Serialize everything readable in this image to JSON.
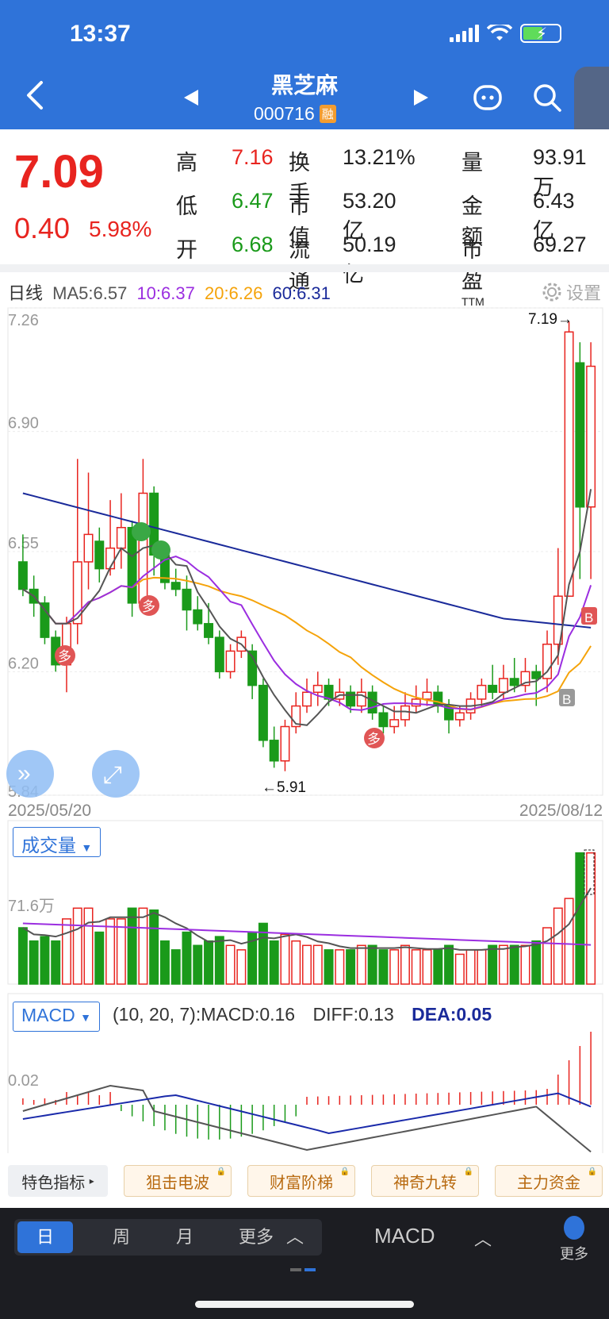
{
  "status": {
    "time": "13:37"
  },
  "header": {
    "name": "黑芝麻",
    "code": "000716",
    "badge": "融"
  },
  "quote": {
    "price": "7.09",
    "change": "0.40",
    "change_pct": "5.98%",
    "fields": [
      {
        "label": "高",
        "value": "7.16",
        "color": "red"
      },
      {
        "label": "换手",
        "value": "13.21%",
        "color": "dark"
      },
      {
        "label": "量",
        "value": "93.91万",
        "color": "dark"
      },
      {
        "label": "低",
        "value": "6.47",
        "color": "green"
      },
      {
        "label": "市值",
        "value": "53.20亿",
        "color": "dark"
      },
      {
        "label": "金额",
        "value": "6.43亿",
        "color": "dark"
      },
      {
        "label": "开",
        "value": "6.68",
        "color": "green"
      },
      {
        "label": "流通",
        "value": "50.19亿",
        "color": "dark"
      },
      {
        "label": "市盈TTM",
        "value": "69.27",
        "color": "dark"
      }
    ]
  },
  "ma": {
    "period": "日线",
    "ma5": "MA5:6.57",
    "ma10": "10:6.37",
    "ma20": "20:6.26",
    "ma60": "60:6.31",
    "settings": "设置"
  },
  "chart_data": {
    "type": "candlestick",
    "y_ticks": [
      "7.26",
      "6.90",
      "6.55",
      "6.20",
      "5.84"
    ],
    "ylim": [
      5.84,
      7.26
    ],
    "high_marker": "7.19→",
    "low_marker": "←5.91",
    "start_date": "2025/05/20",
    "end_date": "2025/08/12",
    "signals": [
      "多",
      "多",
      "多",
      "B",
      "B"
    ],
    "candles": [
      [
        6.52,
        6.44,
        6.6,
        6.42
      ],
      [
        6.44,
        6.4,
        6.48,
        6.36
      ],
      [
        6.4,
        6.3,
        6.42,
        6.28
      ],
      [
        6.3,
        6.22,
        6.32,
        6.2
      ],
      [
        6.22,
        6.34,
        6.36,
        6.14
      ],
      [
        6.34,
        6.52,
        6.82,
        6.28
      ],
      [
        6.52,
        6.6,
        6.78,
        6.44
      ],
      [
        6.58,
        6.5,
        6.62,
        6.46
      ],
      [
        6.5,
        6.56,
        6.7,
        6.48
      ],
      [
        6.56,
        6.62,
        6.72,
        6.5
      ],
      [
        6.62,
        6.4,
        6.64,
        6.36
      ],
      [
        6.4,
        6.72,
        6.82,
        6.38
      ],
      [
        6.72,
        6.54,
        6.74,
        6.48
      ],
      [
        6.54,
        6.46,
        6.56,
        6.44
      ],
      [
        6.46,
        6.44,
        6.5,
        6.42
      ],
      [
        6.44,
        6.38,
        6.48,
        6.32
      ],
      [
        6.38,
        6.34,
        6.42,
        6.32
      ],
      [
        6.34,
        6.3,
        6.4,
        6.28
      ],
      [
        6.3,
        6.2,
        6.32,
        6.18
      ],
      [
        6.2,
        6.26,
        6.28,
        6.18
      ],
      [
        6.26,
        6.3,
        6.32,
        6.24
      ],
      [
        6.26,
        6.16,
        6.28,
        6.12
      ],
      [
        6.16,
        6.0,
        6.18,
        5.98
      ],
      [
        6.0,
        5.94,
        6.04,
        5.92
      ],
      [
        5.94,
        6.04,
        6.06,
        5.91
      ],
      [
        6.04,
        6.1,
        6.14,
        6.02
      ],
      [
        6.1,
        6.14,
        6.18,
        6.08
      ],
      [
        6.14,
        6.16,
        6.2,
        6.1
      ],
      [
        6.16,
        6.12,
        6.18,
        6.1
      ],
      [
        6.12,
        6.14,
        6.18,
        6.1
      ],
      [
        6.14,
        6.1,
        6.16,
        6.08
      ],
      [
        6.1,
        6.14,
        6.18,
        6.08
      ],
      [
        6.14,
        6.08,
        6.16,
        6.06
      ],
      [
        6.08,
        6.04,
        6.1,
        6.02
      ],
      [
        6.04,
        6.06,
        6.1,
        6.02
      ],
      [
        6.06,
        6.1,
        6.14,
        6.04
      ],
      [
        6.1,
        6.12,
        6.16,
        6.08
      ],
      [
        6.12,
        6.14,
        6.18,
        6.1
      ],
      [
        6.14,
        6.1,
        6.16,
        6.08
      ],
      [
        6.1,
        6.06,
        6.12,
        6.02
      ],
      [
        6.06,
        6.08,
        6.1,
        6.04
      ],
      [
        6.08,
        6.12,
        6.14,
        6.06
      ],
      [
        6.12,
        6.16,
        6.18,
        6.1
      ],
      [
        6.16,
        6.14,
        6.22,
        6.12
      ],
      [
        6.14,
        6.18,
        6.22,
        6.12
      ],
      [
        6.18,
        6.16,
        6.24,
        6.14
      ],
      [
        6.16,
        6.2,
        6.24,
        6.14
      ],
      [
        6.2,
        6.18,
        6.22,
        6.1
      ],
      [
        6.18,
        6.28,
        6.32,
        6.14
      ],
      [
        6.28,
        6.42,
        6.56,
        6.22
      ],
      [
        6.42,
        7.19,
        7.22,
        6.48
      ],
      [
        7.1,
        6.68,
        7.16,
        6.47
      ],
      [
        6.68,
        7.09,
        7.16,
        6.47
      ]
    ],
    "volume_label": "成交量",
    "volume_tick": "71.6万",
    "macd_label": "MACD",
    "macd_params": "(10, 20, 7):MACD:0.16",
    "macd_diff": "DIFF:0.13",
    "macd_dea": "DEA:0.05",
    "macd_tick": "0.02"
  },
  "features": {
    "main": "特色指标",
    "items": [
      "狙击电波",
      "财富阶梯",
      "神奇九转",
      "主力资金"
    ]
  },
  "toolbar": {
    "tabs": [
      "日",
      "周",
      "月",
      "更多"
    ],
    "indicator": "MACD",
    "more": "更多"
  }
}
